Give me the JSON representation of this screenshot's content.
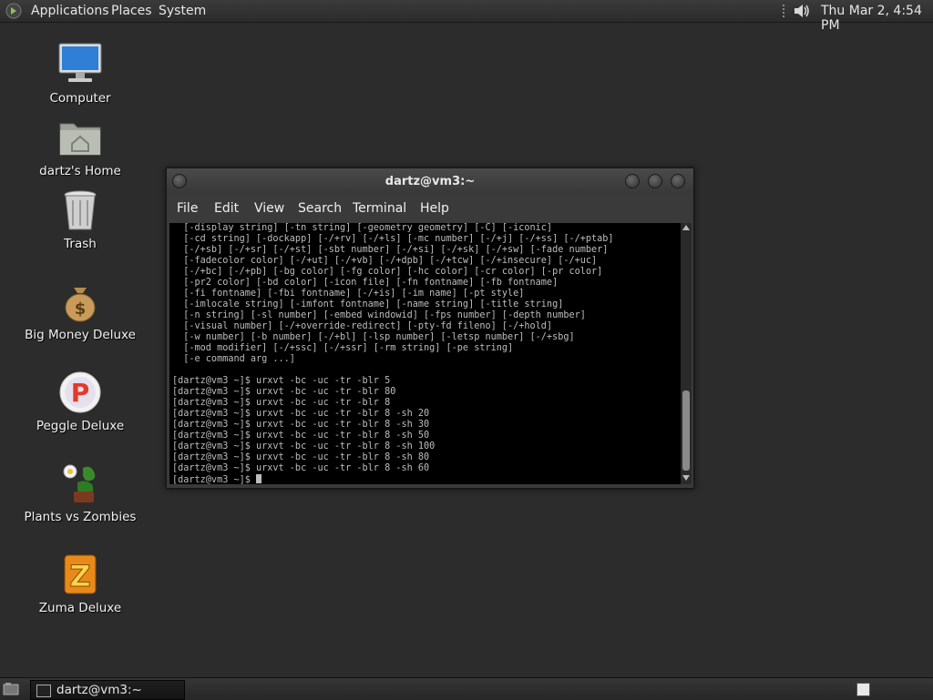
{
  "top_panel": {
    "menus": [
      "Applications",
      "Places",
      "System"
    ],
    "clock": "Thu Mar  2,  4:54 PM"
  },
  "desktop": {
    "icons": [
      {
        "label": "Computer",
        "icon": "computer-icon"
      },
      {
        "label": "dartz's Home",
        "icon": "home-folder-icon"
      },
      {
        "label": "Trash",
        "icon": "trash-icon"
      },
      {
        "label": "Big Money Deluxe",
        "icon": "money-bag-icon"
      },
      {
        "label": "Peggle Deluxe",
        "icon": "peggle-icon"
      },
      {
        "label": "Plants vs Zombies",
        "icon": "plants-zombies-icon"
      },
      {
        "label": "Zuma Deluxe",
        "icon": "zuma-icon"
      }
    ]
  },
  "terminal": {
    "title": "dartz@vm3:~",
    "menu": [
      "File",
      "Edit",
      "View",
      "Search",
      "Terminal",
      "Help"
    ],
    "lines": [
      "  [-display string] [-tn string] [-geometry geometry] [-C] [-iconic]",
      "  [-cd string] [-dockapp] [-/+rv] [-/+ls] [-mc number] [-/+j] [-/+ss] [-/+ptab]",
      "  [-/+sb] [-/+sr] [-/+st] [-sbt number] [-/+si] [-/+sk] [-/+sw] [-fade number]",
      "  [-fadecolor color] [-/+ut] [-/+vb] [-/+dpb] [-/+tcw] [-/+insecure] [-/+uc]",
      "  [-/+bc] [-/+pb] [-bg color] [-fg color] [-hc color] [-cr color] [-pr color]",
      "  [-pr2 color] [-bd color] [-icon file] [-fn fontname] [-fb fontname]",
      "  [-fi fontname] [-fbi fontname] [-/+is] [-im name] [-pt style]",
      "  [-imlocale string] [-imfont fontname] [-name string] [-title string]",
      "  [-n string] [-sl number] [-embed windowid] [-fps number] [-depth number]",
      "  [-visual number] [-/+override-redirect] [-pty-fd fileno] [-/+hold]",
      "  [-w number] [-b number] [-/+bl] [-lsp number] [-letsp number] [-/+sbg]",
      "  [-mod modifier] [-/+ssc] [-/+ssr] [-rm string] [-pe string]",
      "  [-e command arg ...]",
      "",
      "[dartz@vm3 ~]$ urxvt -bc -uc -tr -blr 5",
      "[dartz@vm3 ~]$ urxvt -bc -uc -tr -blr 80",
      "[dartz@vm3 ~]$ urxvt -bc -uc -tr -blr 8",
      "[dartz@vm3 ~]$ urxvt -bc -uc -tr -blr 8 -sh 20",
      "[dartz@vm3 ~]$ urxvt -bc -uc -tr -blr 8 -sh 30",
      "[dartz@vm3 ~]$ urxvt -bc -uc -tr -blr 8 -sh 50",
      "[dartz@vm3 ~]$ urxvt -bc -uc -tr -blr 8 -sh 100",
      "[dartz@vm3 ~]$ urxvt -bc -uc -tr -blr 8 -sh 80",
      "[dartz@vm3 ~]$ urxvt -bc -uc -tr -blr 8 -sh 60",
      "[dartz@vm3 ~]$ "
    ]
  },
  "bottom_panel": {
    "task_label": "dartz@vm3:~"
  }
}
